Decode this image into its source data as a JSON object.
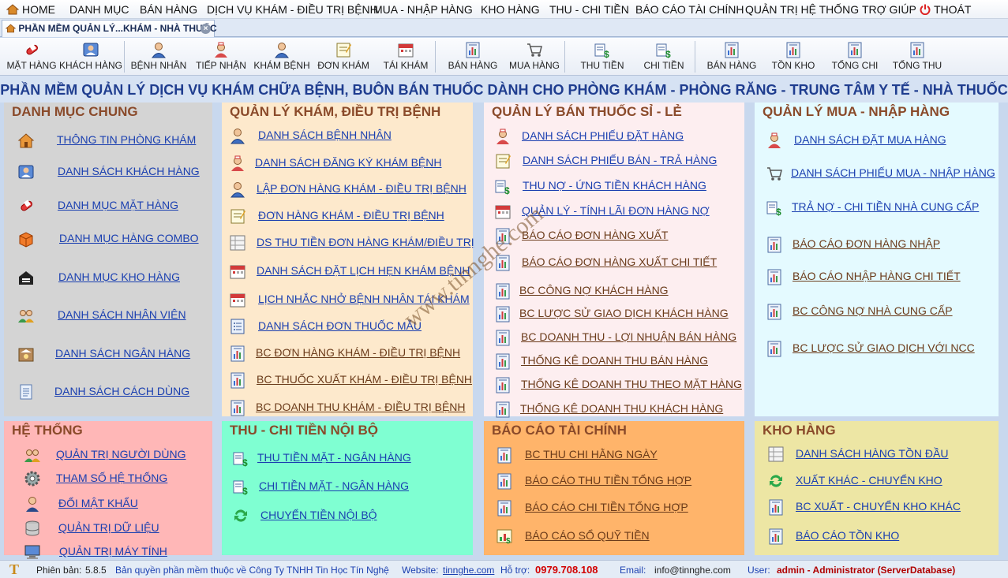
{
  "menu": [
    "HOME",
    "DANH MỤC",
    "BÁN HÀNG",
    "DỊCH VỤ KHÁM - ĐIỀU TRỊ BỆNH",
    "MUA - NHẬP HÀNG",
    "KHO HÀNG",
    "THU - CHI TIỀN",
    "BÁO CÁO TÀI CHÍNH",
    "QUẢN TRỊ HỆ THỐNG",
    "TRỢ GIÚP",
    "THOÁT"
  ],
  "tab": {
    "label": "PHẦN MỀM QUẢN LÝ...KHÁM - NHÀ THUỐC",
    "close": "×"
  },
  "toolbar": [
    "MẶT HÀNG",
    "KHÁCH HÀNG",
    "BỆNH NHÂN",
    "TIẾP NHẬN",
    "KHÁM BỆNH",
    "ĐƠN KHÁM",
    "TÁI KHÁM",
    "BÁN HÀNG",
    "MUA HÀNG",
    "THU TIỀN",
    "CHI TIỀN",
    "BÁN HÀNG",
    "TỒN KHO",
    "TỔNG CHI",
    "TỔNG THU"
  ],
  "title": "PHẦN MỀM QUẢN LÝ DỊCH VỤ KHÁM CHỮA BỆNH, BUÔN BÁN THUỐC DÀNH CHO PHÒNG KHÁM - PHÒNG RĂNG - TRUNG TÂM Y TẾ - NHÀ THUỐC",
  "panels": {
    "danhmuc": {
      "title": "DANH MỤC CHUNG",
      "items": [
        "THÔNG TIN PHÒNG KHÁM",
        "DANH SÁCH KHÁCH HÀNG",
        "DANH MỤC MẶT HÀNG",
        "DANH MỤC HÀNG COMBO",
        "DANH MỤC KHO HÀNG",
        "DANH SÁCH NHÂN VIÊN",
        "DANH SÁCH NGÂN HÀNG",
        "DANH SÁCH CÁCH DÙNG"
      ]
    },
    "kham": {
      "title": "QUẢN LÝ KHÁM, ĐIỀU TRỊ BỆNH",
      "items": [
        "DANH SÁCH BỆNH NHÂN",
        "DANH SÁCH ĐĂNG KÝ KHÁM BỆNH",
        "LẬP ĐƠN HÀNG KHÁM - ĐIỀU TRỊ BỆNH",
        "ĐƠN HÀNG KHÁM - ĐIỀU TRỊ BỆNH",
        "DS THU TIỀN ĐƠN HÀNG KHÁM/ĐIỀU TRỊ",
        "DANH SÁCH ĐẶT LỊCH HẸN KHÁM BỆNH",
        "LỊCH NHẮC NHỞ BỆNH NHÂN TÁI KHÁM",
        "DANH SÁCH ĐƠN THUỐC MẪU",
        "BC ĐƠN HÀNG KHÁM - ĐIỀU TRỊ BỆNH",
        "BC THUỐC XUẤT KHÁM - ĐIỀU TRỊ BỆNH",
        "BC DOANH THU KHÁM - ĐIỀU TRỊ BỆNH"
      ]
    },
    "banthuoc": {
      "title": "QUẢN LÝ BÁN THUỐC SỈ - LẺ",
      "items": [
        "DANH SÁCH PHIẾU ĐẶT HÀNG",
        "DANH SÁCH PHIẾU BÁN - TRẢ HÀNG",
        "THU NỢ - ỨNG TIỀN KHÁCH HÀNG",
        "QUẢN LÝ - TÍNH LÃI ĐƠN HÀNG NỢ",
        "BÁO CÁO ĐƠN HÀNG XUẤT",
        "BÁO CÁO ĐƠN HÀNG XUẤT CHI TIẾT",
        "BC CÔNG NỢ KHÁCH HÀNG",
        "BC LƯỢC SỬ GIAO DỊCH KHÁCH HÀNG",
        "BC DOANH THU - LỢI NHUẬN BÁN HÀNG",
        "THỐNG KÊ DOANH THU BÁN HÀNG",
        "THỐNG KÊ DOANH THU THEO MẶT HÀNG",
        "THỐNG KÊ DOANH THU KHÁCH HÀNG"
      ]
    },
    "mua": {
      "title": "QUẢN LÝ MUA - NHẬP HÀNG",
      "items": [
        "DANH SÁCH ĐẶT MUA HÀNG",
        "DANH SÁCH PHIẾU MUA - NHẬP HÀNG",
        "TRẢ NỢ - CHI TIỀN NHÀ CUNG CẤP",
        "BÁO CÁO ĐƠN HÀNG NHẬP",
        "BÁO CÁO NHẬP HÀNG CHI TIẾT",
        "BC CÔNG NỢ NHÀ CUNG CẤP",
        "BC LƯỢC SỬ GIAO DỊCH VỚI NCC"
      ]
    },
    "hethong": {
      "title": "HỆ THỐNG",
      "items": [
        "QUẢN TRỊ NGƯỜI DÙNG",
        "THAM SỐ HỆ THỐNG",
        "ĐỔI MẬT KHẨU",
        "QUẢN TRỊ DỮ LIỆU",
        "QUẢN TRỊ MÁY TÍNH"
      ]
    },
    "thuchi": {
      "title": "THU - CHI TIỀN NỘI BỘ",
      "items": [
        "THU TIỀN MẶT - NGÂN HÀNG",
        "CHI TIỀN MẶT - NGÂN HÀNG",
        "CHUYỂN TIỀN NỘI BỘ"
      ]
    },
    "baocao": {
      "title": "BÁO CÁO TÀI CHÍNH",
      "items": [
        "BC THU CHI HẰNG NGÀY",
        "BÁO CÁO THU TIỀN TỔNG HỢP",
        "BÁO CÁO CHI TIỀN TỔNG HỢP",
        "BÁO CÁO SỔ QUỸ TIỀN"
      ]
    },
    "kho": {
      "title": "KHO HÀNG",
      "items": [
        "DANH SÁCH HÀNG TỒN ĐẦU",
        "XUẤT KHÁC - CHUYỂN KHO",
        "BC XUẤT - CHUYỂN KHO KHÁC",
        "BÁO CÁO TỒN KHO"
      ]
    }
  },
  "footer": {
    "logo": "T",
    "version_label": "Phiên bản:",
    "version": "5.8.5",
    "copyright": "Bản quyền phần mềm thuộc về Công Ty TNHH Tin Học Tín Nghệ",
    "website_label": "Website:",
    "website": "tinnghe.com",
    "support_label": "Hỗ trợ:",
    "support": "0979.708.108",
    "email_label": "Email:",
    "email": "info@tinnghe.com",
    "user_label": "User:",
    "user": "admin - Administrator (ServerDatabase)"
  },
  "watermark": "www.tinnghe.com",
  "colors": {
    "panel_gray": "#d4d4d4",
    "panel_orange_light": "#fde9cc",
    "panel_pink": "#fdeef0",
    "panel_cyan": "#e4faff",
    "panel_red": "#ffb7b7",
    "panel_green": "#7fffd2",
    "panel_orange": "#ffb46a",
    "panel_yellow": "#ede6a4"
  }
}
